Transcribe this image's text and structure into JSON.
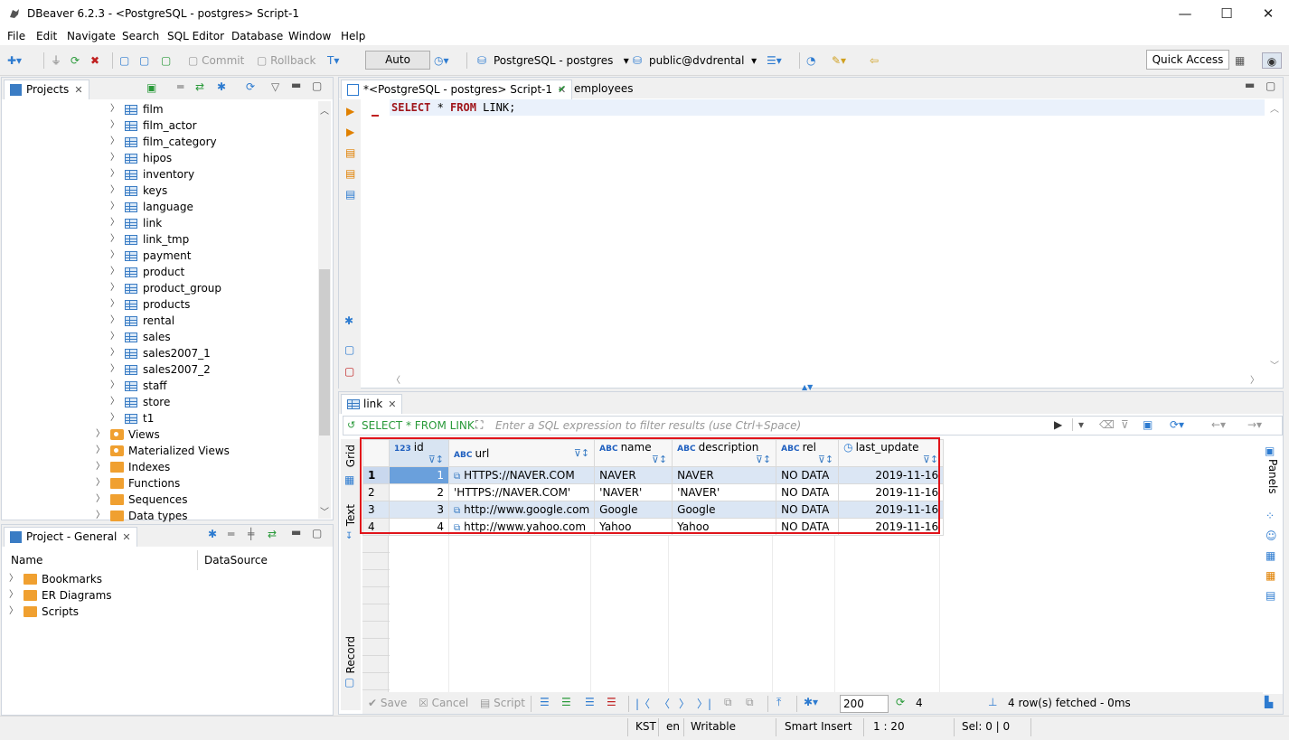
{
  "window": {
    "title": "DBeaver 6.2.3 - <PostgreSQL - postgres> Script-1",
    "minimize": "—",
    "maximize": "☐",
    "close": "✕"
  },
  "menu": [
    "File",
    "Edit",
    "Navigate",
    "Search",
    "SQL Editor",
    "Database",
    "Window",
    "Help"
  ],
  "toolbar": {
    "commit": "Commit",
    "rollback": "Rollback",
    "auto": "Auto",
    "connection": "PostgreSQL - postgres",
    "schema": "public@dvdrental",
    "quick_access": "Quick Access"
  },
  "projects_panel": {
    "tab": "Projects",
    "tables": [
      "film",
      "film_actor",
      "film_category",
      "hipos",
      "inventory",
      "keys",
      "language",
      "link",
      "link_tmp",
      "payment",
      "product",
      "product_group",
      "products",
      "rental",
      "sales",
      "sales2007_1",
      "sales2007_2",
      "staff",
      "store",
      "t1"
    ],
    "folders": [
      "Views",
      "Materialized Views",
      "Indexes",
      "Functions",
      "Sequences",
      "Data types"
    ]
  },
  "project_general": {
    "tab": "Project - General",
    "col_name": "Name",
    "col_datasource": "DataSource",
    "items": [
      "Bookmarks",
      "ER Diagrams",
      "Scripts"
    ]
  },
  "editor": {
    "tab_script": "*<PostgreSQL - postgres> Script-1",
    "tab_employees": "employees",
    "sql_kw1": "SELECT",
    "sql_mid": " * ",
    "sql_kw2": "FROM",
    "sql_rest": " LINK;"
  },
  "results": {
    "tab": "link",
    "query_label": "SELECT * FROM LINK",
    "filter_placeholder": "Enter a SQL expression to filter results (use Ctrl+Space)",
    "side_grid": "Grid",
    "side_text": "Text",
    "side_record": "Record",
    "side_panels": "Panels",
    "columns": [
      {
        "type": "123",
        "name": "id"
      },
      {
        "type": "ABC",
        "name": "url"
      },
      {
        "type": "ABC",
        "name": "name"
      },
      {
        "type": "ABC",
        "name": "description"
      },
      {
        "type": "ABC",
        "name": "rel"
      },
      {
        "type": "",
        "name": "last_update"
      }
    ],
    "rows": [
      {
        "n": "1",
        "id": "1",
        "url": "HTTPS://NAVER.COM",
        "name": "NAVER",
        "description": "NAVER",
        "rel": "NO DATA",
        "last_update": "2019-11-16"
      },
      {
        "n": "2",
        "id": "2",
        "url": "'HTTPS://NAVER.COM'",
        "name": "'NAVER'",
        "description": "'NAVER'",
        "rel": "NO DATA",
        "last_update": "2019-11-16"
      },
      {
        "n": "3",
        "id": "3",
        "url": "http://www.google.com",
        "name": "Google",
        "description": "Google",
        "rel": "NO DATA",
        "last_update": "2019-11-16"
      },
      {
        "n": "4",
        "id": "4",
        "url": "http://www.yahoo.com",
        "name": "Yahoo",
        "description": "Yahoo",
        "rel": "NO DATA",
        "last_update": "2019-11-16"
      }
    ],
    "bottom": {
      "save": "Save",
      "cancel": "Cancel",
      "script": "Script",
      "fetch_size": "200",
      "row_count": "4",
      "status": "4 row(s) fetched - 0ms"
    }
  },
  "statusbar": {
    "timezone": "KST",
    "locale": "en",
    "mode": "Writable",
    "insert": "Smart Insert",
    "position": "1 : 20",
    "selection": "Sel: 0 | 0"
  },
  "colors": {
    "highlight_border": "#e0141b",
    "accent": "#3a7cc4"
  }
}
